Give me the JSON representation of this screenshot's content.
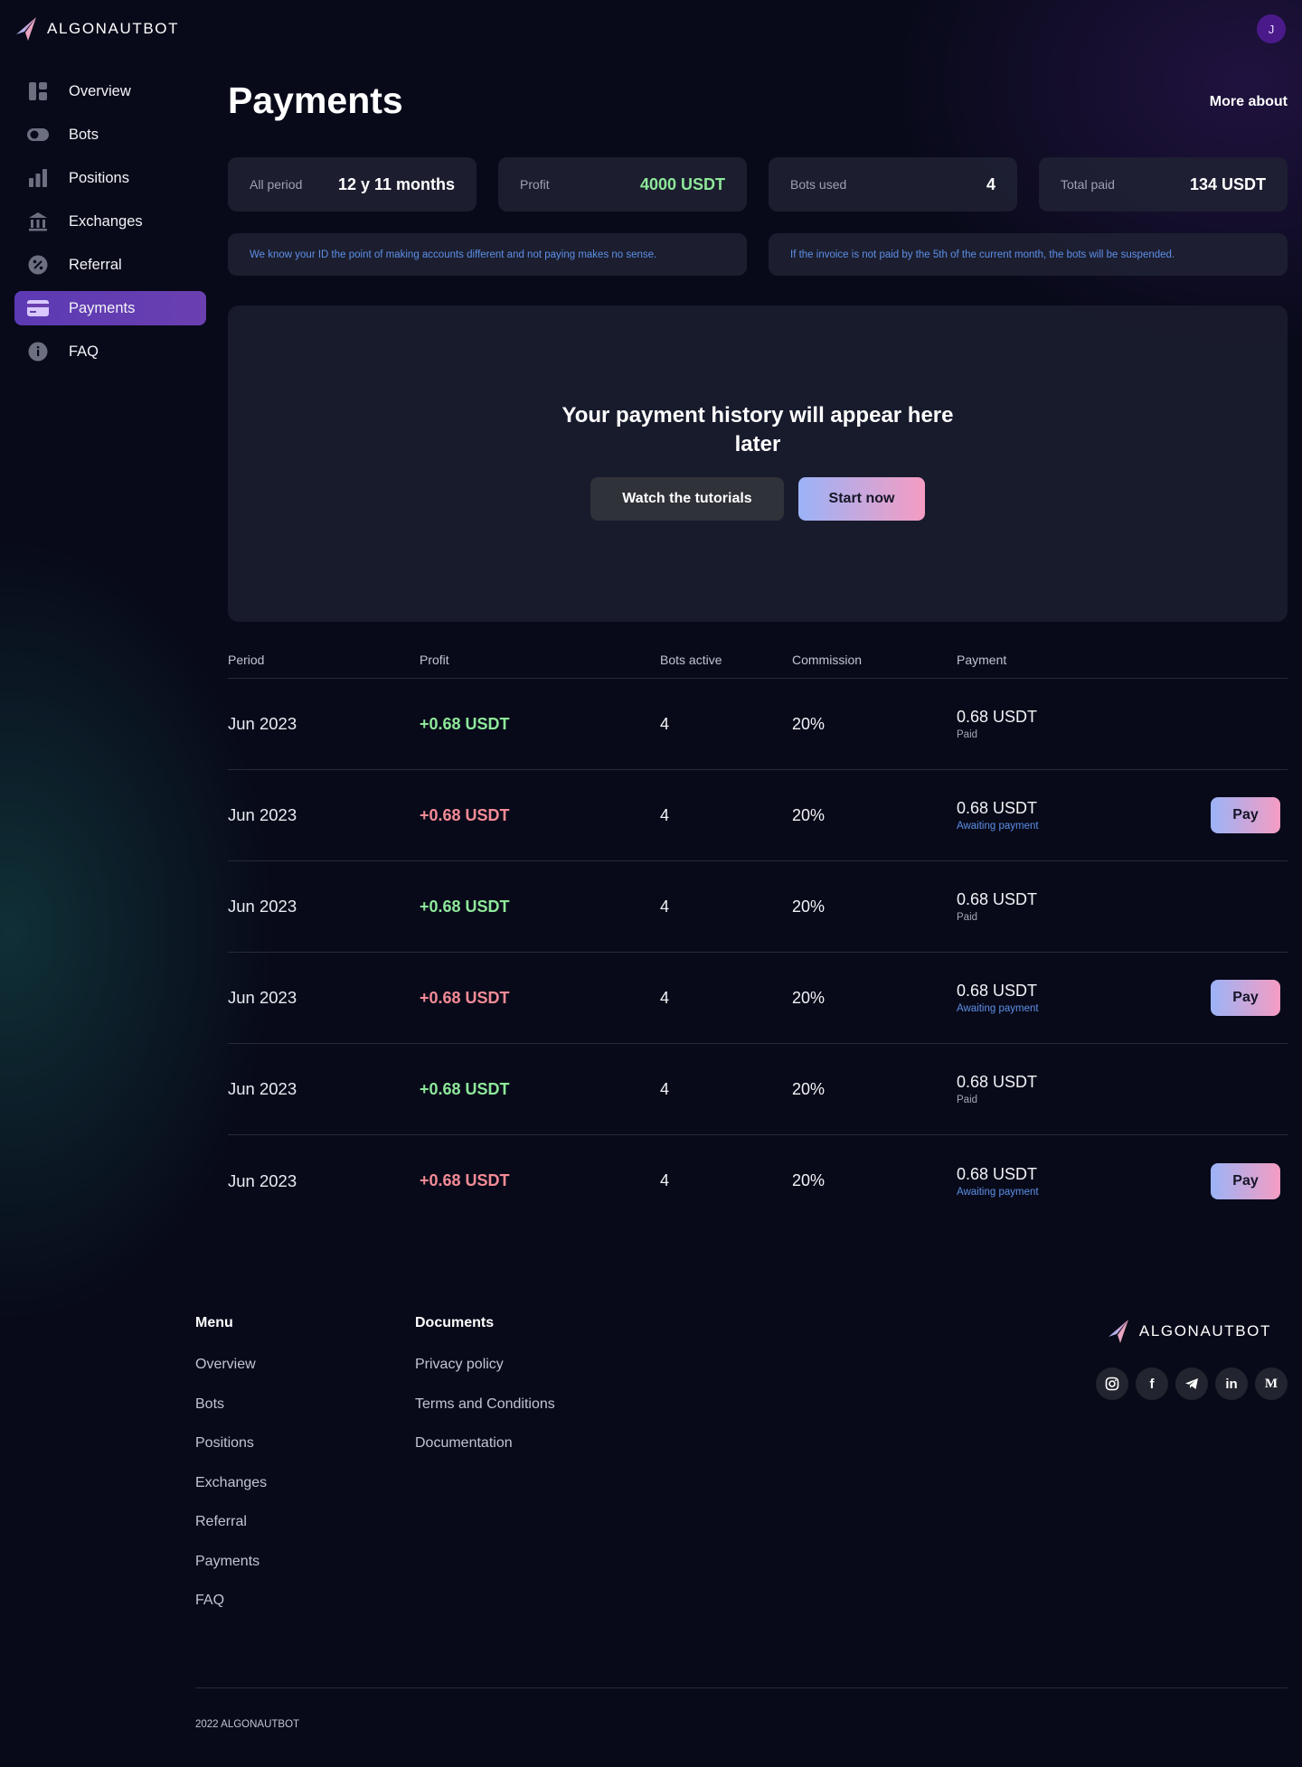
{
  "brand": {
    "name": "ALGONAUTBOT"
  },
  "user": {
    "avatar_initial": "J"
  },
  "sidebar": {
    "items": [
      {
        "label": "Overview",
        "icon": "dashboard-icon",
        "active": false
      },
      {
        "label": "Bots",
        "icon": "toggle-icon",
        "active": false
      },
      {
        "label": "Positions",
        "icon": "bar-chart-icon",
        "active": false
      },
      {
        "label": "Exchanges",
        "icon": "bank-icon",
        "active": false
      },
      {
        "label": "Referral",
        "icon": "percent-icon",
        "active": false
      },
      {
        "label": "Payments",
        "icon": "credit-card-icon",
        "active": true
      },
      {
        "label": "FAQ",
        "icon": "info-icon",
        "active": false
      }
    ]
  },
  "header": {
    "title": "Payments",
    "more_about": "More about"
  },
  "stats": [
    {
      "label": "All period",
      "value": "12 y 11 months"
    },
    {
      "label": "Profit",
      "value": "4000 USDT"
    },
    {
      "label": "Bots used",
      "value": "4"
    },
    {
      "label": "Total paid",
      "value": "134 USDT"
    }
  ],
  "notes": [
    "We know your ID the point of making accounts different and not paying makes no sense.",
    "If the invoice is not paid by the 5th of the current month, the bots will be suspended."
  ],
  "empty_state": {
    "title": "Your payment history will appear here later",
    "tutorials_button": "Watch the tutorials",
    "start_button": "Start now"
  },
  "table": {
    "columns": [
      "Period",
      "Profit",
      "Bots active",
      "Commission",
      "Payment"
    ],
    "pay_label": "Pay",
    "rows": [
      {
        "period": "Jun 2023",
        "profit": "+0.68 USDT",
        "bots": "4",
        "commission": "20%",
        "amount": "0.68 USDT",
        "status": "Paid"
      },
      {
        "period": "Jun 2023",
        "profit": "+0.68 USDT",
        "bots": "4",
        "commission": "20%",
        "amount": "0.68 USDT",
        "status": "Awaiting payment"
      },
      {
        "period": "Jun 2023",
        "profit": "+0.68 USDT",
        "bots": "4",
        "commission": "20%",
        "amount": "0.68 USDT",
        "status": "Paid"
      },
      {
        "period": "Jun 2023",
        "profit": "+0.68 USDT",
        "bots": "4",
        "commission": "20%",
        "amount": "0.68 USDT",
        "status": "Awaiting payment"
      },
      {
        "period": "Jun 2023",
        "profit": "+0.68 USDT",
        "bots": "4",
        "commission": "20%",
        "amount": "0.68 USDT",
        "status": "Paid"
      },
      {
        "period": "Jun 2023",
        "profit": "+0.68 USDT",
        "bots": "4",
        "commission": "20%",
        "amount": "0.68 USDT",
        "status": "Awaiting payment"
      }
    ]
  },
  "footer": {
    "menu_heading": "Menu",
    "menu_links": [
      "Overview",
      "Bots",
      "Positions",
      "Exchanges",
      "Referral",
      "Payments",
      "FAQ"
    ],
    "docs_heading": "Documents",
    "docs_links": [
      "Privacy policy",
      "Terms and Conditions",
      "Documentation"
    ],
    "socials": [
      {
        "icon": "instagram-icon",
        "glyph": ""
      },
      {
        "icon": "facebook-icon",
        "glyph": "f"
      },
      {
        "icon": "telegram-icon",
        "glyph": ""
      },
      {
        "icon": "linkedin-icon",
        "glyph": "in"
      },
      {
        "icon": "medium-icon",
        "glyph": "M"
      }
    ],
    "copyright": "2022 ALGONAUTBOT"
  },
  "colors": {
    "background": "#080a19",
    "accent_purple": "#5c3ab4",
    "profit_green": "#8ee89a",
    "profit_red": "#f48b97",
    "status_blue": "#5d8fe6",
    "gradient_start": "#9bb3f7",
    "gradient_end": "#f59cc2"
  }
}
